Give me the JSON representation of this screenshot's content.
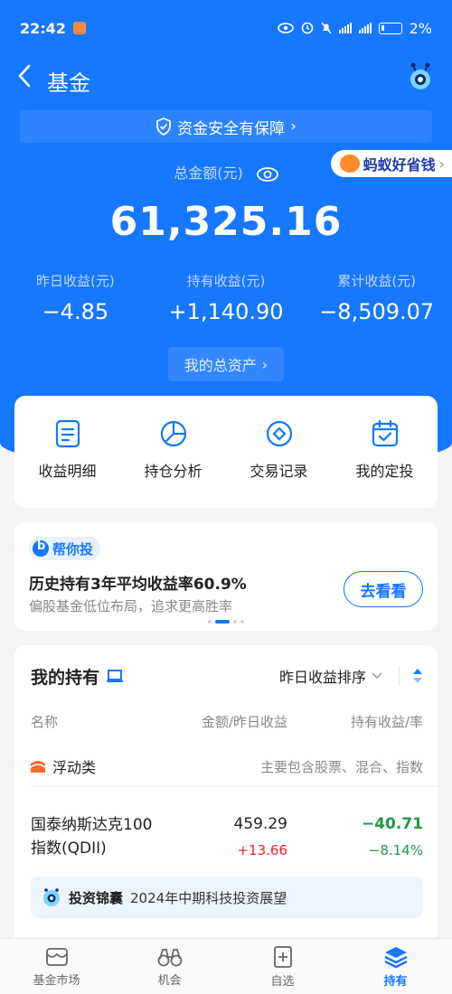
{
  "status_bar": {
    "time": "22:42",
    "battery": "2%",
    "net1": "5G",
    "net2": "5G"
  },
  "nav": {
    "back_icon": "chevron-left-icon",
    "title": "基金"
  },
  "safety_banner": {
    "label": "资金安全有保障"
  },
  "mayi_badge": {
    "label": "蚂蚁好省钱"
  },
  "summary": {
    "total_label": "总金额(元)",
    "total_amount": "61,325.16",
    "stats": [
      {
        "label": "昨日收益(元)",
        "value": "−4.85"
      },
      {
        "label": "持有收益(元)",
        "value": "+1,140.90"
      },
      {
        "label": "累计收益(元)",
        "value": "−8,509.07"
      }
    ],
    "assets_button": "我的总资产"
  },
  "menu": [
    {
      "label": "收益明细",
      "icon": "document-icon"
    },
    {
      "label": "持仓分析",
      "icon": "pie-chart-icon"
    },
    {
      "label": "交易记录",
      "icon": "exchange-record-icon"
    },
    {
      "label": "我的定投",
      "icon": "calendar-check-icon"
    }
  ],
  "promo": {
    "tag": "帮你投",
    "headline": "历史持有3年平均收益率60.9%",
    "subtitle": "偏股基金低位布局，追求更高胜率",
    "button": "去看看"
  },
  "holdings": {
    "title": "我的持有",
    "sort_label": "昨日收益排序",
    "columns": [
      "名称",
      "金额/昨日收益",
      "持有收益/率"
    ],
    "category": {
      "name": "浮动类",
      "desc": "主要包含股票、混合、指数"
    },
    "funds": [
      {
        "name_line1": "国泰纳斯达克100",
        "name_line2": "指数(QDII)",
        "amount": "459.29",
        "day_change": "+13.66",
        "hold_profit": "−40.71",
        "hold_rate": "−8.14%"
      }
    ],
    "insight": {
      "title": "投资锦囊",
      "text": "2024年中期科技投资展望"
    }
  },
  "tabbar": [
    {
      "label": "基金市场",
      "icon": "market-icon",
      "active": false
    },
    {
      "label": "机会",
      "icon": "binoculars-icon",
      "active": false
    },
    {
      "label": "自选",
      "icon": "watchlist-add-icon",
      "active": false
    },
    {
      "label": "持有",
      "icon": "layers-icon",
      "active": true
    }
  ],
  "colors": {
    "brand": "#1677ff",
    "loss": "#1e9a47",
    "gain": "#f5222d"
  }
}
